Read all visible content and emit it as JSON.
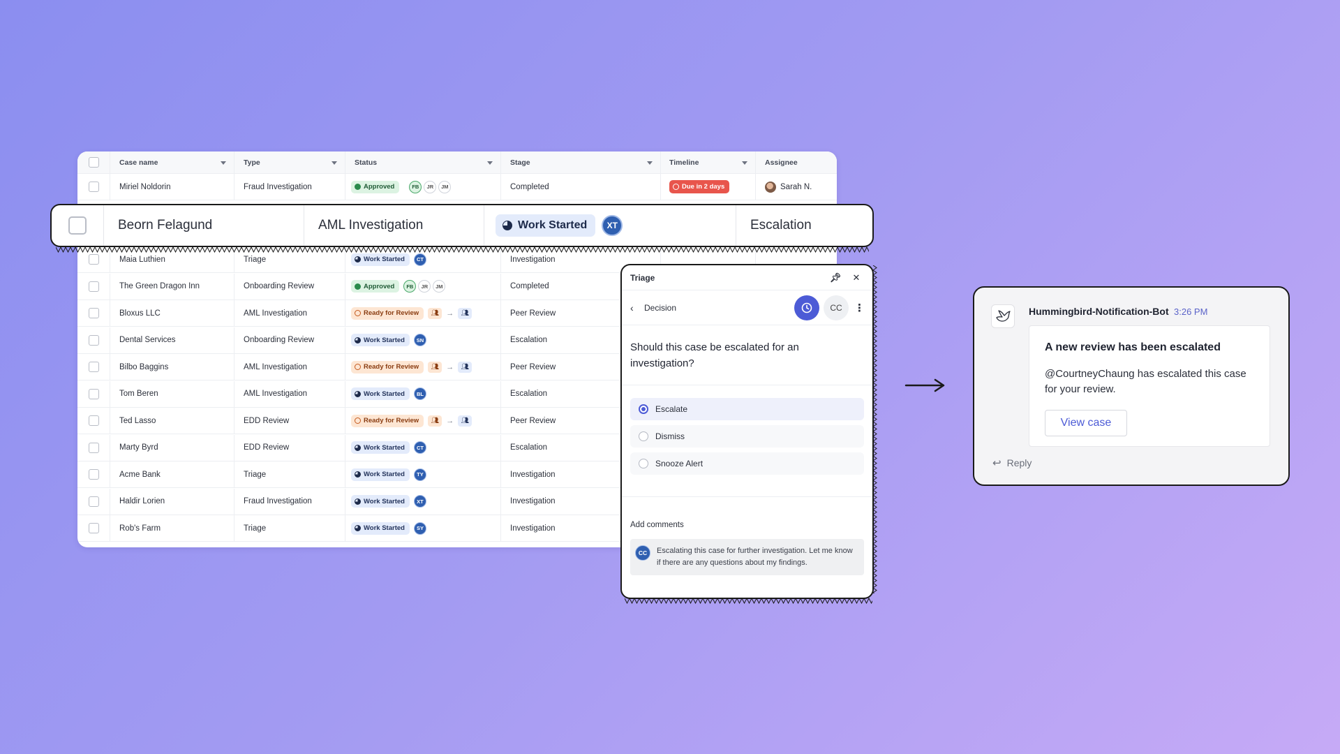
{
  "table": {
    "headers": {
      "case_name": "Case name",
      "type": "Type",
      "status": "Status",
      "stage": "Stage",
      "timeline": "Timeline",
      "assignee": "Assignee"
    },
    "first_row": {
      "name": "Miriel Noldorin",
      "type": "Fraud Investigation",
      "status": "Approved",
      "avatars": [
        "FB",
        "JR",
        "JM"
      ],
      "stage": "Completed",
      "timeline": "Due in 2 days",
      "assignee": "Sarah N."
    },
    "rows": [
      {
        "name": "Maia Luthien",
        "type": "Triage",
        "status": "Work Started",
        "avatar": "CT",
        "stage": "Investigation"
      },
      {
        "name": "The Green Dragon Inn",
        "type": "Onboarding Review",
        "status": "Approved",
        "avatars": [
          "FB",
          "JR",
          "JM"
        ],
        "stage": "Completed"
      },
      {
        "name": "Bloxus LLC",
        "type": "AML Investigation",
        "status": "Ready for Review",
        "stage": "Peer Review"
      },
      {
        "name": "Dental Services",
        "type": "Onboarding Review",
        "status": "Work Started",
        "avatar": "SN",
        "stage": "Escalation"
      },
      {
        "name": "Bilbo Baggins",
        "type": "AML Investigation",
        "status": "Ready for Review",
        "stage": "Peer Review"
      },
      {
        "name": "Tom Beren",
        "type": "AML Investigation",
        "status": "Work Started",
        "avatar": "BL",
        "stage": "Escalation"
      },
      {
        "name": "Ted Lasso",
        "type": "EDD Review",
        "status": "Ready for Review",
        "stage": "Peer Review"
      },
      {
        "name": "Marty Byrd",
        "type": "EDD Review",
        "status": "Work Started",
        "avatar": "CT",
        "stage": "Escalation"
      },
      {
        "name": "Acme Bank",
        "type": "Triage",
        "status": "Work Started",
        "avatar": "TY",
        "stage": "Investigation"
      },
      {
        "name": "Haldir Lorien",
        "type": "Fraud Investigation",
        "status": "Work Started",
        "avatar": "XT",
        "stage": "Investigation"
      },
      {
        "name": "Rob's Farm",
        "type": "Triage",
        "status": "Work Started",
        "avatar": "SY",
        "stage": "Investigation"
      }
    ]
  },
  "zoom_row": {
    "name": "Beorn Felagund",
    "type": "AML Investigation",
    "status": "Work Started",
    "avatar": "XT",
    "stage": "Escalation"
  },
  "triage": {
    "title": "Triage",
    "section": "Decision",
    "cc": "CC",
    "question": "Should this case be escalated for an investigation?",
    "options": [
      "Escalate",
      "Dismiss",
      "Snooze Alert"
    ],
    "selected_option": "Escalate",
    "comments_label": "Add comments",
    "comment_avatar": "CC",
    "comment": "Escalating this case for further investigation. Let me know if there are any questions about my findings."
  },
  "notification": {
    "bot_name": "Hummingbird-Notification-Bot",
    "time": "3:26 PM",
    "title": "A new review has been escalated",
    "body": "@CourtneyChaung has escalated this case for your review.",
    "button": "View case",
    "reply": "Reply"
  },
  "colors": {
    "accent": "#4c5bd6",
    "work_started_bg": "#e3ebfb",
    "approved_bg": "#dcf3e2",
    "ready_bg": "#fde6d3",
    "due_bg": "#e8554c"
  }
}
